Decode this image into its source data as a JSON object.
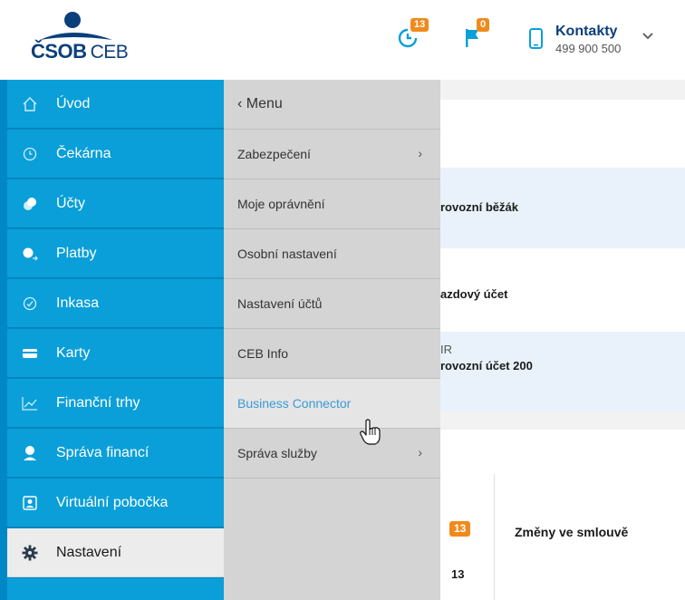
{
  "brand": {
    "name": "ČSOB",
    "suffix": "CEB"
  },
  "header": {
    "waiting_badge": "13",
    "flag_badge": "0",
    "contacts_title": "Kontakty",
    "contacts_phone": "499 900 500"
  },
  "main_menu": [
    {
      "label": "Úvod",
      "icon": "home-icon"
    },
    {
      "label": "Čekárna",
      "icon": "clock-icon"
    },
    {
      "label": "Účty",
      "icon": "coins-icon"
    },
    {
      "label": "Platby",
      "icon": "payment-icon"
    },
    {
      "label": "Inkasa",
      "icon": "collection-icon"
    },
    {
      "label": "Karty",
      "icon": "card-icon"
    },
    {
      "label": "Finanční trhy",
      "icon": "chart-icon"
    },
    {
      "label": "Správa financí",
      "icon": "finance-person-icon"
    },
    {
      "label": "Virtuální pobočka",
      "icon": "branch-icon"
    },
    {
      "label": "Nastavení",
      "icon": "gear-icon"
    }
  ],
  "submenu": {
    "back_label": "‹ Menu",
    "items": [
      {
        "label": "Zabezpečení",
        "has_children": true
      },
      {
        "label": "Moje oprávnění",
        "has_children": false
      },
      {
        "label": "Osobní nastavení",
        "has_children": false
      },
      {
        "label": "Nastavení účtů",
        "has_children": false
      },
      {
        "label": "CEB Info",
        "has_children": false
      },
      {
        "label": "Business Connector",
        "has_children": false
      },
      {
        "label": "Správa služby",
        "has_children": true
      }
    ]
  },
  "content": {
    "account1": "rovozní běžák",
    "account2": "azdový účet",
    "account3_currency": "IR",
    "account3": "rovozní účet 200",
    "notice_badge": "13",
    "notice_count": "13",
    "notice_title": "Změny ve smlouvě"
  },
  "colors": {
    "menu_blue": "#0a9fd8",
    "menu_dark": "#0088c6",
    "submenu_grey": "#d4d4d4",
    "link_blue": "#3a9bd6",
    "badge_orange": "#f08a1c",
    "brand_navy": "#0b3f7c"
  }
}
